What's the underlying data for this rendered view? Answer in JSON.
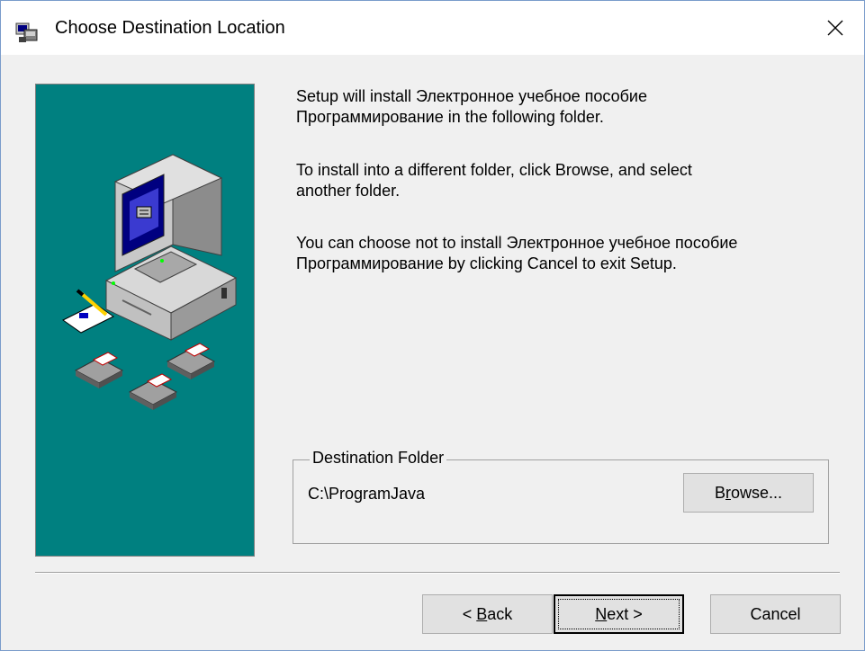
{
  "window": {
    "title": "Choose Destination Location"
  },
  "intro": {
    "p1_line1": "Setup will install Электронное учебное пособие",
    "p1_line2": "Программирование in the following folder.",
    "p2_line1": "To install into a different folder, click Browse, and select",
    "p2_line2": "another folder.",
    "p3_line1": "You can choose not to install Электронное учебное пособие",
    "p3_line2": "Программирование by clicking Cancel to exit Setup."
  },
  "destination": {
    "group_label": "Destination Folder",
    "path": "C:\\ProgramJava",
    "browse_mnemonic": "r",
    "browse_pre": "B",
    "browse_post": "owse..."
  },
  "buttons": {
    "back_prefix": "< ",
    "back_mnemonic": "B",
    "back_rest": "ack",
    "next_mnemonic": "N",
    "next_rest": "ext >",
    "cancel": "Cancel"
  },
  "colors": {
    "art_background": "#008080",
    "window_background": "#f0f0f0",
    "titlebar": "#ffffff"
  },
  "icons": {
    "app": "setup-app-icon",
    "close": "close-icon",
    "art": "computer-setup-illustration"
  }
}
